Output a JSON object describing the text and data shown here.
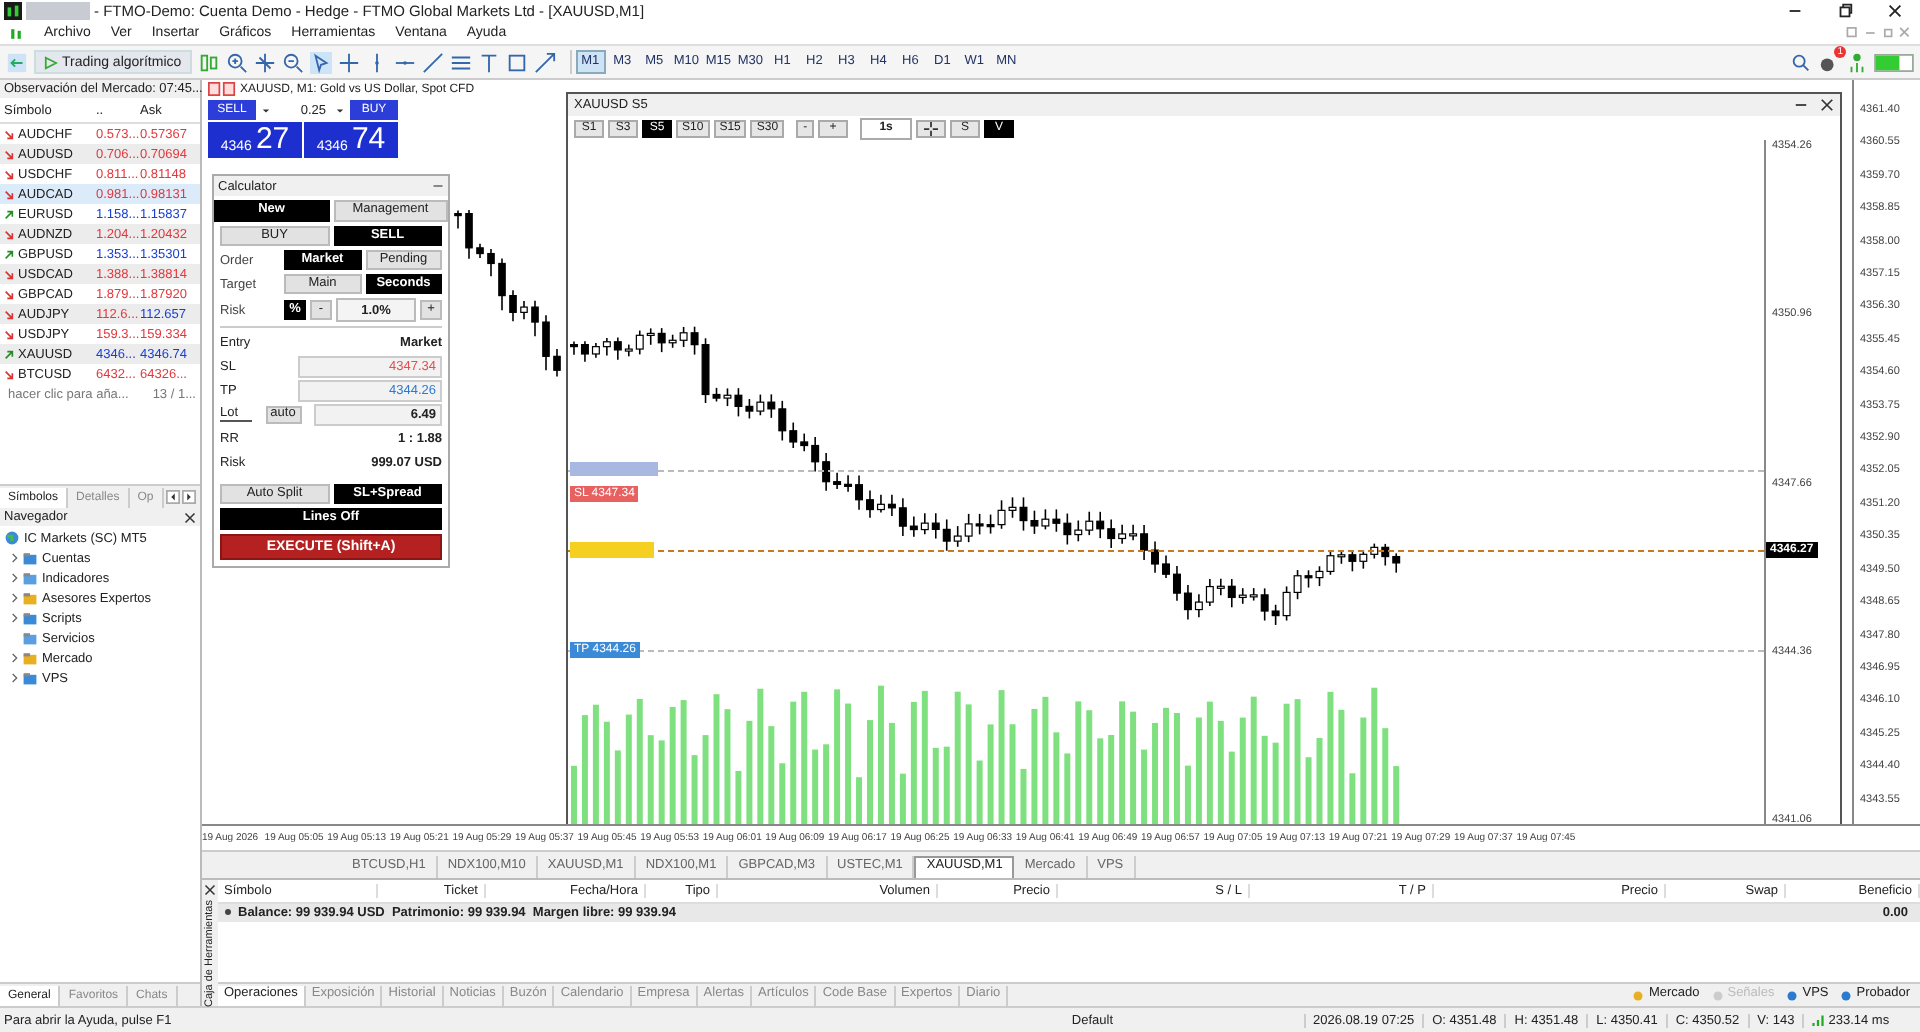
{
  "window": {
    "title": "- FTMO-Demo: Cuenta Demo - Hedge - FTMO Global Markets Ltd - [XAUUSD,M1]"
  },
  "menu": [
    "Archivo",
    "Ver",
    "Insertar",
    "Gráficos",
    "Herramientas",
    "Ventana",
    "Ayuda"
  ],
  "toolbar": {
    "algo_button": "Trading algorítmico",
    "notifications": "1",
    "timeframes": [
      {
        "label": "M1",
        "selected": true
      },
      {
        "label": "M3",
        "selected": false
      },
      {
        "label": "M5",
        "selected": false
      },
      {
        "label": "M10",
        "selected": false
      },
      {
        "label": "M15",
        "selected": false
      },
      {
        "label": "M30",
        "selected": false
      },
      {
        "label": "H1",
        "selected": false
      },
      {
        "label": "H2",
        "selected": false
      },
      {
        "label": "H3",
        "selected": false
      },
      {
        "label": "H4",
        "selected": false
      },
      {
        "label": "H6",
        "selected": false
      },
      {
        "label": "D1",
        "selected": false
      },
      {
        "label": "W1",
        "selected": false
      },
      {
        "label": "MN",
        "selected": false
      }
    ]
  },
  "market_watch": {
    "title": "Observación del Mercado: 07:45...",
    "columns": [
      "Símbolo",
      "..",
      "Ask"
    ],
    "rows": [
      {
        "symbol": "AUDCHF",
        "bid": "0.573...",
        "ask": "0.57367",
        "up": false,
        "bid_up": false,
        "ask_up": false,
        "selected": false
      },
      {
        "symbol": "AUDUSD",
        "bid": "0.706...",
        "ask": "0.70694",
        "up": false,
        "bid_up": false,
        "ask_up": false,
        "selected": false
      },
      {
        "symbol": "USDCHF",
        "bid": "0.811...",
        "ask": "0.81148",
        "up": false,
        "bid_up": false,
        "ask_up": false,
        "selected": false
      },
      {
        "symbol": "AUDCAD",
        "bid": "0.981...",
        "ask": "0.98131",
        "up": false,
        "bid_up": false,
        "ask_up": false,
        "selected": true
      },
      {
        "symbol": "EURUSD",
        "bid": "1.158...",
        "ask": "1.15837",
        "up": true,
        "bid_up": true,
        "ask_up": true,
        "selected": false
      },
      {
        "symbol": "AUDNZD",
        "bid": "1.204...",
        "ask": "1.20432",
        "up": false,
        "bid_up": false,
        "ask_up": false,
        "selected": false
      },
      {
        "symbol": "GBPUSD",
        "bid": "1.353...",
        "ask": "1.35301",
        "up": true,
        "bid_up": true,
        "ask_up": true,
        "selected": false
      },
      {
        "symbol": "USDCAD",
        "bid": "1.388...",
        "ask": "1.38814",
        "up": false,
        "bid_up": false,
        "ask_up": false,
        "selected": false
      },
      {
        "symbol": "GBPCAD",
        "bid": "1.879...",
        "ask": "1.87920",
        "up": false,
        "bid_up": false,
        "ask_up": false,
        "selected": false
      },
      {
        "symbol": "AUDJPY",
        "bid": "112.6...",
        "ask": "112.657",
        "up": false,
        "bid_up": false,
        "ask_up": true,
        "selected": false
      },
      {
        "symbol": "USDJPY",
        "bid": "159.3...",
        "ask": "159.334",
        "up": false,
        "bid_up": false,
        "ask_up": false,
        "selected": false
      },
      {
        "symbol": "XAUUSD",
        "bid": "4346...",
        "ask": "4346.74",
        "up": true,
        "bid_up": true,
        "ask_up": true,
        "selected": false
      },
      {
        "symbol": "BTCUSD",
        "bid": "6432...",
        "ask": "64326...",
        "up": false,
        "bid_up": false,
        "ask_up": false,
        "selected": false
      }
    ],
    "add_hint": "hacer clic para aña...",
    "count": "13 / 1...",
    "tabs": [
      {
        "label": "Símbolos",
        "selected": true
      },
      {
        "label": "Detalles",
        "selected": false
      },
      {
        "label": "Op",
        "selected": false
      }
    ]
  },
  "navigator": {
    "title": "Navegador",
    "root": "IC Markets (SC) MT5",
    "children": [
      {
        "label": "Cuentas",
        "expandable": true
      },
      {
        "label": "Indicadores",
        "expandable": true
      },
      {
        "label": "Asesores Expertos",
        "expandable": true
      },
      {
        "label": "Scripts",
        "expandable": true
      },
      {
        "label": "Servicios",
        "expandable": false
      },
      {
        "label": "Mercado",
        "expandable": true
      },
      {
        "label": "VPS",
        "expandable": true
      }
    ]
  },
  "left_tabs": [
    {
      "label": "General",
      "selected": true
    },
    {
      "label": "Favoritos",
      "selected": false
    },
    {
      "label": "Chats",
      "selected": false
    }
  ],
  "chart": {
    "header": "XAUUSD, M1:  Gold vs US Dollar, Spot CFD",
    "one_click": {
      "sell": "SELL",
      "volume": "0.25",
      "buy": "BUY",
      "sell_big": "4346",
      "sell_pts": "27",
      "buy_big": "4346",
      "buy_pts": "74"
    },
    "price_axis": [
      "4361.40",
      "4360.55",
      "4359.70",
      "4358.85",
      "4358.00",
      "4357.15",
      "4356.30",
      "4355.45",
      "4354.60",
      "4353.75",
      "4352.90",
      "4352.05",
      "4351.20",
      "4350.35",
      "4349.50",
      "4348.65",
      "4347.80",
      "4346.95",
      "4346.10",
      "4345.25",
      "4344.40",
      "4343.55"
    ],
    "time_axis": [
      "19 Aug 2026",
      "19 Aug 05:05",
      "19 Aug 05:13",
      "19 Aug 05:21",
      "19 Aug 05:29",
      "19 Aug 05:37",
      "19 Aug 05:45",
      "19 Aug 05:53",
      "19 Aug 06:01",
      "19 Aug 06:09",
      "19 Aug 06:17",
      "19 Aug 06:25",
      "19 Aug 06:33",
      "19 Aug 06:41",
      "19 Aug 06:49",
      "19 Aug 06:57",
      "19 Aug 07:05",
      "19 Aug 07:13",
      "19 Aug 07:21",
      "19 Aug 07:29",
      "19 Aug 07:37",
      "19 Aug 07:45"
    ]
  },
  "calculator": {
    "title": "Calculator",
    "tabs": [
      {
        "label": "New",
        "selected": true
      },
      {
        "label": "Management",
        "selected": false
      }
    ],
    "sides": [
      {
        "label": "BUY",
        "selected": false
      },
      {
        "label": "SELL",
        "selected": true
      }
    ],
    "order": {
      "label": "Order",
      "options": [
        {
          "label": "Market",
          "selected": true
        },
        {
          "label": "Pending",
          "selected": false
        }
      ]
    },
    "target": {
      "label": "Target",
      "options": [
        {
          "label": "Main",
          "selected": false
        },
        {
          "label": "Seconds",
          "selected": true
        }
      ]
    },
    "risk": {
      "label": "Risk",
      "unit": "%",
      "minus": "-",
      "value": "1.0%",
      "plus": "+"
    },
    "entry": {
      "label": "Entry",
      "value": "Market"
    },
    "sl": {
      "label": "SL",
      "value": "4347.34"
    },
    "tp": {
      "label": "TP",
      "value": "4344.26"
    },
    "lot": {
      "label": "Lot",
      "auto": "auto",
      "value": "6.49"
    },
    "rr": {
      "label": "RR",
      "value": "1 : 1.88"
    },
    "risk_amount": {
      "label": "Risk",
      "value": "999.07 USD"
    },
    "toggles": [
      {
        "label": "Auto Split",
        "selected": false
      },
      {
        "label": "SL+Spread",
        "selected": true
      }
    ],
    "lines": "Lines Off",
    "execute": "EXECUTE (Shift+A)"
  },
  "s5_window": {
    "title": "XAUUSD  S5",
    "periods": [
      {
        "label": "S1",
        "selected": false
      },
      {
        "label": "S3",
        "selected": false
      },
      {
        "label": "S5",
        "selected": true
      },
      {
        "label": "S10",
        "selected": false
      },
      {
        "label": "S15",
        "selected": false
      },
      {
        "label": "S30",
        "selected": false
      }
    ],
    "minus": "-",
    "plus": "+",
    "step": "1s",
    "s_button": {
      "label": "S",
      "selected": false
    },
    "v_button": {
      "label": "V",
      "selected": true
    },
    "sl_tag": "SL 4347.34",
    "tp_tag": "TP 4344.26",
    "current_price": "4346.27",
    "price_axis": [
      "4354.26",
      "4350.96",
      "4347.66",
      "4344.36",
      "4341.06"
    ]
  },
  "chart_tabs": [
    {
      "label": "BTCUSD,H1",
      "selected": false
    },
    {
      "label": "NDX100,M10",
      "selected": false
    },
    {
      "label": "XAUUSD,M1",
      "selected": false
    },
    {
      "label": "NDX100,M1",
      "selected": false
    },
    {
      "label": "GBPCAD,M3",
      "selected": false
    },
    {
      "label": "USTEC,M1",
      "selected": false
    },
    {
      "label": "XAUUSD,M1",
      "selected": true
    },
    {
      "label": "Mercado",
      "selected": false
    },
    {
      "label": "VPS",
      "selected": false
    }
  ],
  "toolbox": {
    "side_label": "Caja de Herramientas",
    "columns": [
      "Símbolo",
      "Ticket",
      "Fecha/Hora",
      "Tipo",
      "Volumen",
      "Precio",
      "S / L",
      "T / P",
      "Precio",
      "Swap",
      "Beneficio"
    ],
    "balance": "Balance: 99 939.94 USD  Patrimonio: 99 939.94  Margen libre: 99 939.94",
    "profit": "0.00",
    "tabs": [
      {
        "label": "Operaciones",
        "selected": true
      },
      {
        "label": "Exposición",
        "selected": false
      },
      {
        "label": "Historial",
        "selected": false
      },
      {
        "label": "Noticias",
        "selected": false
      },
      {
        "label": "Buzón",
        "selected": false
      },
      {
        "label": "Calendario",
        "selected": false
      },
      {
        "label": "Empresa",
        "selected": false
      },
      {
        "label": "Alertas",
        "selected": false
      },
      {
        "label": "Artículos",
        "selected": false
      },
      {
        "label": "Code Base",
        "selected": false
      },
      {
        "label": "Expertos",
        "selected": false
      },
      {
        "label": "Diario",
        "selected": false
      }
    ],
    "services": [
      {
        "label": "Mercado",
        "disabled": false
      },
      {
        "label": "Señales",
        "disabled": true
      },
      {
        "label": "VPS",
        "disabled": false
      },
      {
        "label": "Probador",
        "disabled": false
      }
    ]
  },
  "status_bar": {
    "help": "Para abrir la Ayuda, pulse F1",
    "profile": "Default",
    "time": "2026.08.19 07:25",
    "open": "O: 4351.48",
    "high": "H: 4351.48",
    "low": "L: 4350.41",
    "close": "C: 4350.52",
    "volume": "V: 143",
    "ping": "233.14 ms"
  }
}
